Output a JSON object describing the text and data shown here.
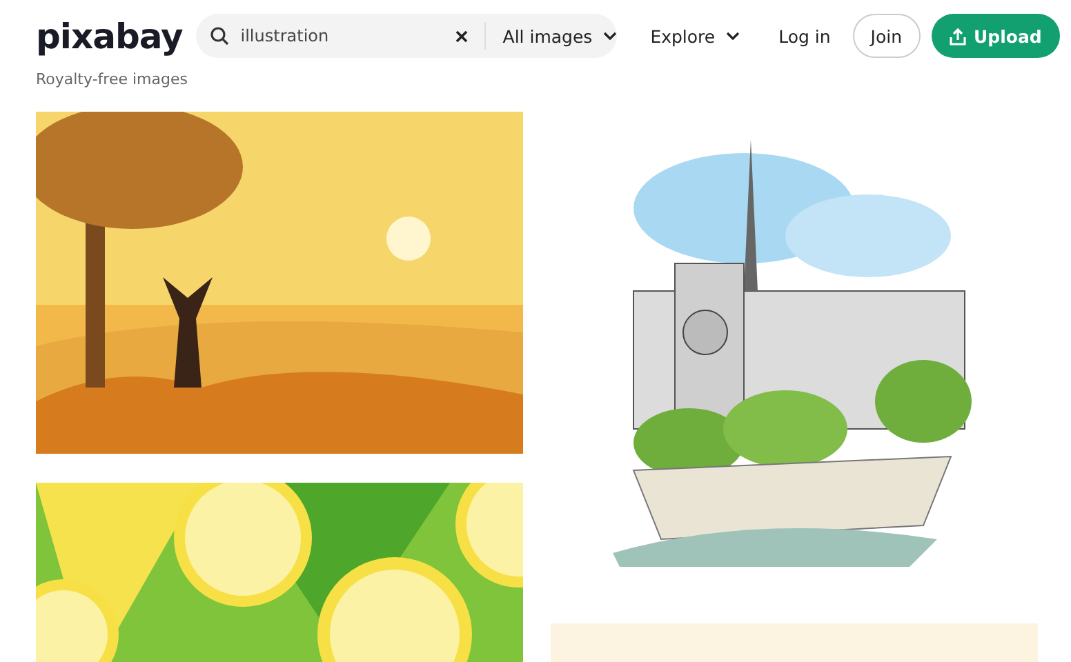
{
  "header": {
    "logo": "pixabay",
    "search": {
      "value": "illustration"
    },
    "filter": {
      "label": "All images"
    },
    "nav": [
      {
        "kind": "menu",
        "label": "Explore"
      },
      {
        "kind": "link",
        "label": "Log in"
      },
      {
        "kind": "outline",
        "label": "Join"
      },
      {
        "kind": "primary",
        "label": "Upload"
      }
    ]
  },
  "subtitle": "Royalty-free images"
}
